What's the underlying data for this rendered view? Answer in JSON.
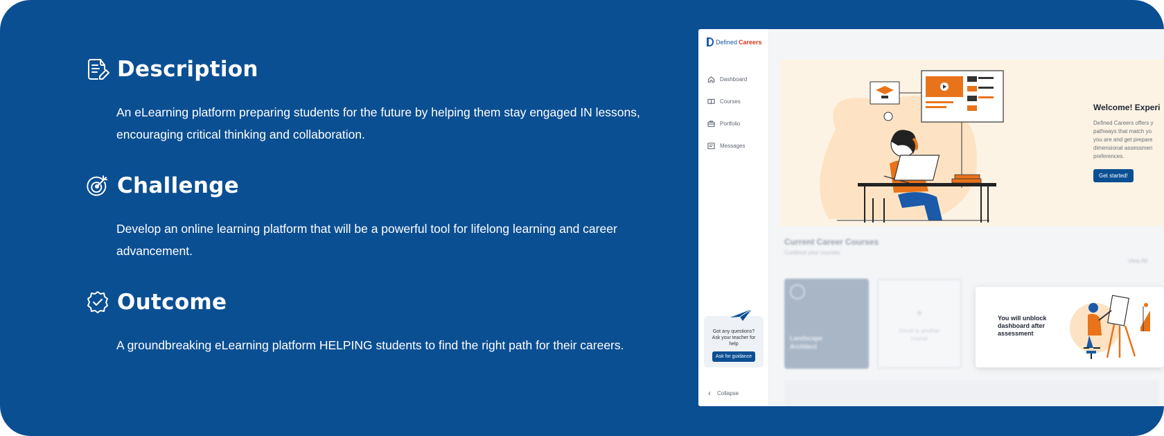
{
  "sections": {
    "description": {
      "title": "Description",
      "text": "An eLearning platform preparing students for the future by helping them stay engaged IN lessons, encouraging critical thinking and collaboration."
    },
    "challenge": {
      "title": "Challenge",
      "text": "Develop an online learning platform that will be a powerful tool for lifelong learning and career advancement."
    },
    "outcome": {
      "title": "Outcome",
      "text": "A groundbreaking eLearning platform HELPING students to find the right path for their careers."
    }
  },
  "app": {
    "logo": {
      "part1": "Defined",
      "part2": "Careers"
    },
    "nav": [
      {
        "label": "Dashboard",
        "icon": "home-icon"
      },
      {
        "label": "Courses",
        "icon": "book-icon"
      },
      {
        "label": "Portfolio",
        "icon": "briefcase-icon"
      },
      {
        "label": "Messages",
        "icon": "message-icon"
      }
    ],
    "help": {
      "line1": "Got any questions?",
      "line2": "Ask your teacher for",
      "line3": "help",
      "button": "Ask for guidance"
    },
    "collapse": "Collapse",
    "hero": {
      "title": "Welcome! Experi",
      "sub1": "Defined Careers offers y",
      "sub2": "pathways that match yo",
      "sub3": "you are and get prepare",
      "sub4": "dimensional assessmen",
      "sub5": "preferences.",
      "button": "Get started!"
    },
    "courses": {
      "title": "Current Career Courses",
      "subtitle": "Continue your courses",
      "view_all": "View All",
      "card_label1": "Landscape",
      "card_label2": "Architect",
      "enrol1": "Enroll to another",
      "enrol2": "course"
    },
    "unlock": {
      "line1": "You will unblock",
      "line2": "dashboard after",
      "line3": "assessment"
    }
  },
  "colors": {
    "background": "#0b4f93",
    "accent_orange": "#e8731a",
    "button_blue": "#0b4f93",
    "brand_red": "#d9361d"
  }
}
